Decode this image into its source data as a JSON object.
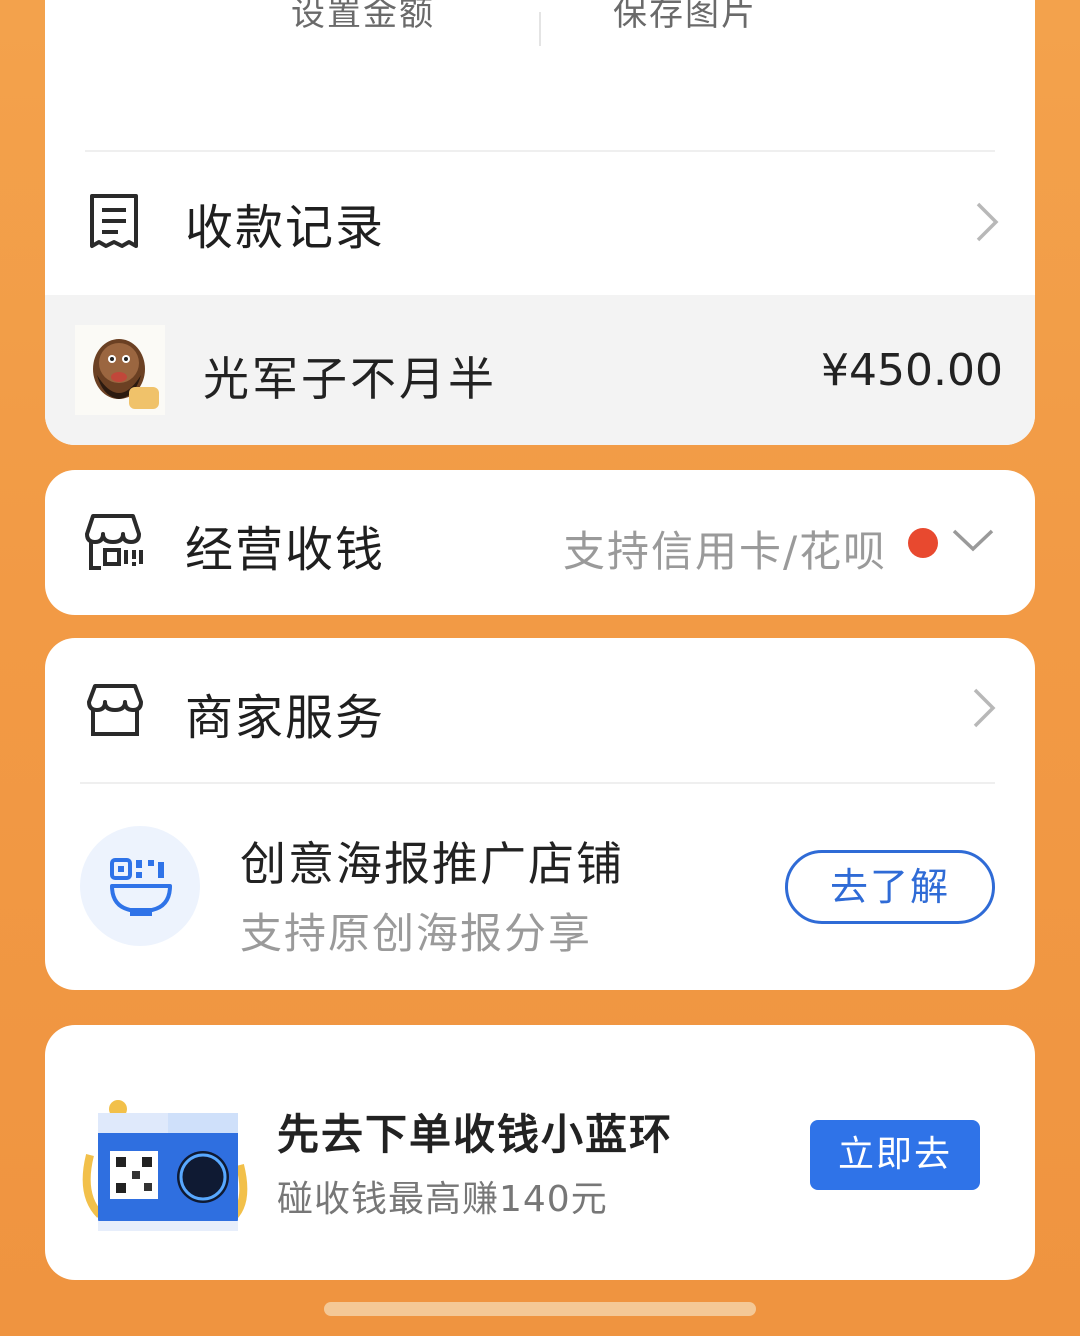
{
  "top_card": {
    "actions": [
      "设置金额",
      "保存图片"
    ],
    "records_title": "收款记录",
    "record": {
      "payer": "光军子不月半",
      "amount": "¥450.00"
    }
  },
  "business": {
    "title": "经营收钱",
    "subtitle": "支持信用卡/花呗"
  },
  "merchant": {
    "title": "商家服务",
    "promo": {
      "title": "创意海报推广店铺",
      "subtitle": "支持原创海报分享",
      "button": "去了解"
    }
  },
  "ad": {
    "title": "先去下单收钱小蓝环",
    "subtitle": "碰收钱最高赚140元",
    "button": "立即去"
  },
  "colors": {
    "background": "#f29a45",
    "primary_blue": "#2f73e8",
    "notification_red": "#e8492f"
  }
}
